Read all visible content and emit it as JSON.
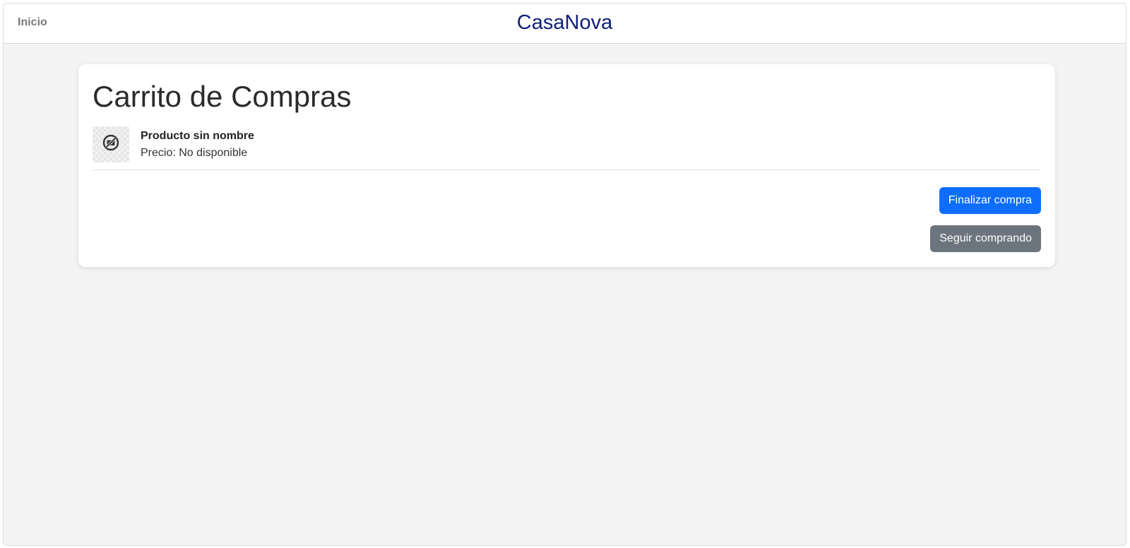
{
  "navbar": {
    "home_label": "Inicio",
    "brand": "CasaNova",
    "brand_color": "#0f1f7a"
  },
  "cart": {
    "title": "Carrito de Compras",
    "items": [
      {
        "name": "Producto sin nombre",
        "price_label": "Precio:",
        "price_value": "No disponible",
        "image_icon": "image-unavailable-icon"
      }
    ],
    "checkout_label": "Finalizar compra",
    "continue_label": "Seguir comprando"
  },
  "colors": {
    "primary": "#0d6efd",
    "secondary": "#6c757d",
    "background": "#f4f4f4"
  }
}
